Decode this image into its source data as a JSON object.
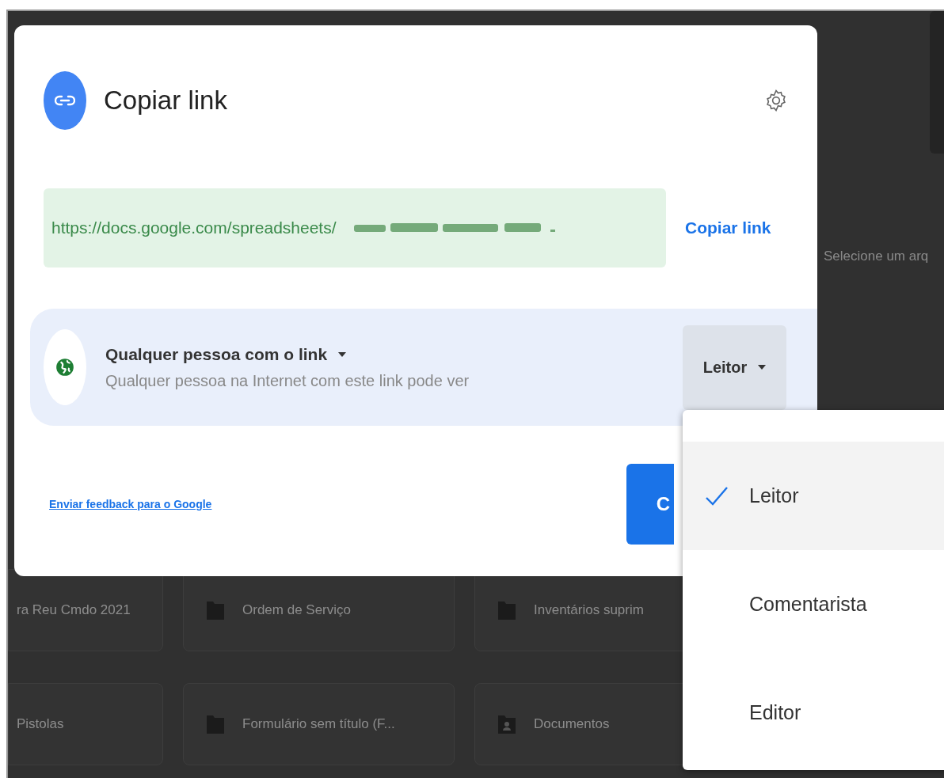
{
  "background": {
    "side_text": "Selecione um arq",
    "files": [
      {
        "name": "ra Reu Cmdo 2021",
        "kind": "none"
      },
      {
        "name": "Ordem de Serviço",
        "kind": "folder"
      },
      {
        "name": "Inventários suprim",
        "kind": "folder"
      },
      {
        "name": "Pistolas",
        "kind": "none"
      },
      {
        "name": "Formulário sem título (F...",
        "kind": "folder"
      },
      {
        "name": "Documentos",
        "kind": "shared-folder"
      }
    ]
  },
  "dialog": {
    "title": "Copiar link",
    "link": {
      "url": "https://docs.google.com/spreadsheets/",
      "action": "Copiar link"
    },
    "access": {
      "scope": "Qualquer pessoa com o link",
      "description": "Qualquer pessoa na Internet com este link pode ver",
      "role": "Leitor"
    },
    "feedback_link": "Enviar feedback para o Google",
    "done_button": "C"
  },
  "role_menu": {
    "items": [
      {
        "label": "Leitor",
        "selected": true
      },
      {
        "label": "Comentarista",
        "selected": false
      },
      {
        "label": "Editor",
        "selected": false
      }
    ]
  }
}
